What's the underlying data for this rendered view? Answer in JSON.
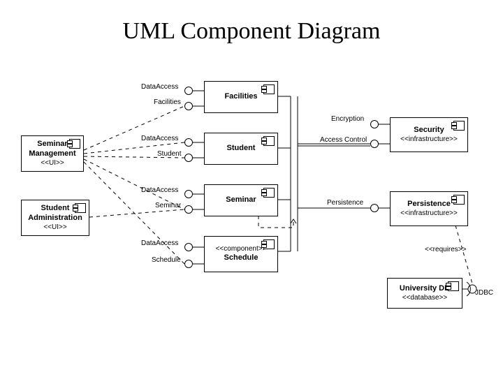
{
  "title": "UML Component Diagram",
  "components": {
    "seminarMgmt": {
      "name": "Seminar Management",
      "stereo": "<<UI>>"
    },
    "studentAdmin": {
      "name": "Student Administration",
      "stereo": "<<UI>>"
    },
    "facilities": {
      "name": "Facilities",
      "stereo": ""
    },
    "student": {
      "name": "Student",
      "stereo": ""
    },
    "seminar": {
      "name": "Seminar",
      "stereo": ""
    },
    "schedule": {
      "name": "Schedule",
      "stereo": "<<component>>"
    },
    "security": {
      "name": "Security",
      "stereo": "<<infrastructure>>"
    },
    "persistence": {
      "name": "Persistence",
      "stereo": "<<infrastructure>>"
    },
    "universityDB": {
      "name": "University DB",
      "stereo": "<<database>>"
    }
  },
  "interfaces": {
    "fac_data": "DataAccess",
    "fac_fac": "Facilities",
    "stu_data": "DataAccess",
    "stu_stu": "Student",
    "sem_data": "DataAccess",
    "sem_sem": "Seminar",
    "sch_data": "DataAccess",
    "sch_sch": "Schedule",
    "encryption": "Encryption",
    "accessControl": "Access Control",
    "persistenceI": "Persistence",
    "requires": "<<requires>>",
    "jdbc": "JDBC"
  }
}
